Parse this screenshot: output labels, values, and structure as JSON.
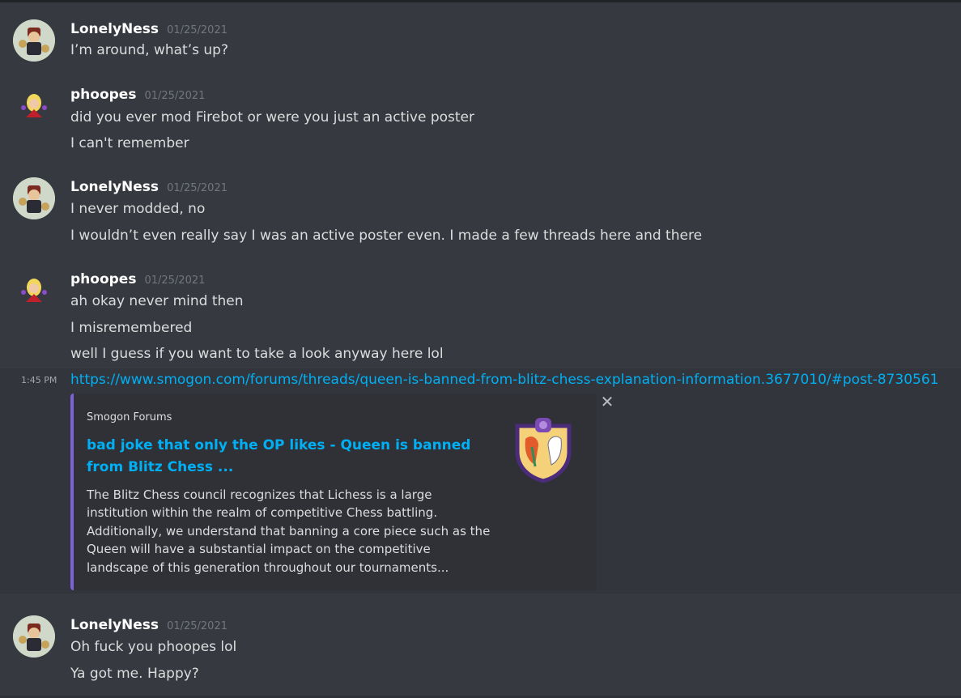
{
  "messages": [
    {
      "username": "LonelyNess",
      "date": "01/25/2021",
      "lines": [
        "I’m around, what’s up?"
      ]
    },
    {
      "username": "phoopes",
      "date": "01/25/2021",
      "lines": [
        "did you ever mod Firebot or were you just an active poster",
        "I can't remember"
      ]
    },
    {
      "username": "LonelyNess",
      "date": "01/25/2021",
      "lines": [
        "I never modded, no",
        "I wouldn’t even really say I was an active poster even. I made a few threads here and there"
      ]
    },
    {
      "username": "phoopes",
      "date": "01/25/2021",
      "lines": [
        "ah okay never mind then",
        "I misremembered",
        "well I guess if you want to take a look anyway here lol"
      ]
    },
    {
      "username": "LonelyNess",
      "date": "01/25/2021",
      "lines": [
        "Oh fuck you phoopes lol",
        "Ya got me. Happy?"
      ]
    }
  ],
  "link_message": {
    "side_time": "1:45 PM",
    "url": "https://www.smogon.com/forums/threads/queen-is-banned-from-blitz-chess-explanation-information.3677010/#post-8730561"
  },
  "embed": {
    "provider": "Smogon Forums",
    "title": "bad joke that only the OP likes - Queen is banned from Blitz Chess ...",
    "description": "The Blitz Chess council recognizes that Lichess is a large institution within the realm of competitive Chess battling. Additionally, we understand that banning a core piece such as the Queen will have a substantial impact on the competitive landscape of this generation throughout our tournaments...",
    "close_icon": "close-icon",
    "thumbnail_icon": "smogon-logo",
    "accent_color": "#7f63d6"
  },
  "colors": {
    "background": "#36393f",
    "link": "#00aff4",
    "username": "#ffffff",
    "timestamp": "#72767d"
  }
}
